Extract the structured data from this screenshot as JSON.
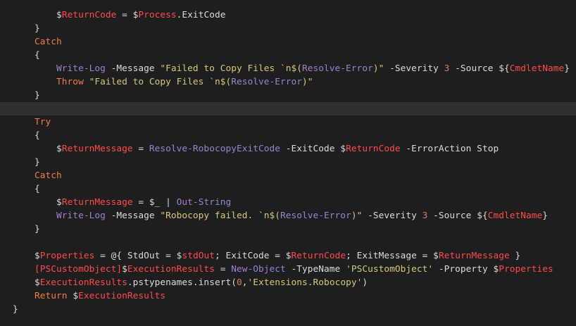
{
  "editor": {
    "colors": {
      "background": "#1e1e1e",
      "current_line": "#303030",
      "default": "#dcdcdc",
      "variable": "#ff4b4b",
      "keyword": "#f27d43",
      "cmdlet": "#a080d0",
      "string": "#d6c97a",
      "number": "#d08060",
      "type": "#ff4b4b"
    },
    "current_line_index": 7,
    "lines": [
      {
        "tokens": [
          {
            "t": "        ",
            "c": "default"
          },
          {
            "t": "$",
            "c": "default"
          },
          {
            "t": "ReturnCode",
            "c": "variable"
          },
          {
            "t": " = ",
            "c": "default"
          },
          {
            "t": "$",
            "c": "default"
          },
          {
            "t": "Process",
            "c": "variable"
          },
          {
            "t": ".ExitCode",
            "c": "default"
          }
        ]
      },
      {
        "tokens": [
          {
            "t": "    }",
            "c": "default"
          }
        ]
      },
      {
        "tokens": [
          {
            "t": "    ",
            "c": "default"
          },
          {
            "t": "Catch",
            "c": "keyword"
          }
        ]
      },
      {
        "tokens": [
          {
            "t": "    {",
            "c": "default"
          }
        ]
      },
      {
        "tokens": [
          {
            "t": "        ",
            "c": "default"
          },
          {
            "t": "Write-Log",
            "c": "cmdlet"
          },
          {
            "t": " -Message ",
            "c": "default"
          },
          {
            "t": "\"Failed to Copy Files `n$(",
            "c": "string"
          },
          {
            "t": "Resolve-Error",
            "c": "cmdlet"
          },
          {
            "t": ")\"",
            "c": "string"
          },
          {
            "t": " -Severity ",
            "c": "default"
          },
          {
            "t": "3",
            "c": "number"
          },
          {
            "t": " -Source ",
            "c": "default"
          },
          {
            "t": "${",
            "c": "default"
          },
          {
            "t": "CmdletName",
            "c": "variable"
          },
          {
            "t": "}",
            "c": "default"
          }
        ]
      },
      {
        "tokens": [
          {
            "t": "        ",
            "c": "default"
          },
          {
            "t": "Throw",
            "c": "keyword"
          },
          {
            "t": " ",
            "c": "default"
          },
          {
            "t": "\"Failed to Copy Files `n$(",
            "c": "string"
          },
          {
            "t": "Resolve-Error",
            "c": "cmdlet"
          },
          {
            "t": ")\"",
            "c": "string"
          }
        ]
      },
      {
        "tokens": [
          {
            "t": "    }",
            "c": "default"
          }
        ]
      },
      {
        "tokens": [
          {
            "t": "",
            "c": "default"
          }
        ]
      },
      {
        "tokens": [
          {
            "t": "    ",
            "c": "default"
          },
          {
            "t": "Try",
            "c": "keyword"
          }
        ]
      },
      {
        "tokens": [
          {
            "t": "    {",
            "c": "default"
          }
        ]
      },
      {
        "tokens": [
          {
            "t": "        ",
            "c": "default"
          },
          {
            "t": "$",
            "c": "default"
          },
          {
            "t": "ReturnMessage",
            "c": "variable"
          },
          {
            "t": " = ",
            "c": "default"
          },
          {
            "t": "Resolve-RobocopyExitCode",
            "c": "cmdlet"
          },
          {
            "t": " -ExitCode ",
            "c": "default"
          },
          {
            "t": "$",
            "c": "default"
          },
          {
            "t": "ReturnCode",
            "c": "variable"
          },
          {
            "t": " -ErrorAction Stop",
            "c": "default"
          }
        ]
      },
      {
        "tokens": [
          {
            "t": "    }",
            "c": "default"
          }
        ]
      },
      {
        "tokens": [
          {
            "t": "    ",
            "c": "default"
          },
          {
            "t": "Catch",
            "c": "keyword"
          }
        ]
      },
      {
        "tokens": [
          {
            "t": "    {",
            "c": "default"
          }
        ]
      },
      {
        "tokens": [
          {
            "t": "        ",
            "c": "default"
          },
          {
            "t": "$",
            "c": "default"
          },
          {
            "t": "ReturnMessage",
            "c": "variable"
          },
          {
            "t": " = ",
            "c": "default"
          },
          {
            "t": "$_",
            "c": "default"
          },
          {
            "t": " | ",
            "c": "default"
          },
          {
            "t": "Out-String",
            "c": "cmdlet"
          }
        ]
      },
      {
        "tokens": [
          {
            "t": "        ",
            "c": "default"
          },
          {
            "t": "Write-Log",
            "c": "cmdlet"
          },
          {
            "t": " -Message ",
            "c": "default"
          },
          {
            "t": "\"Robocopy failed. `n$(",
            "c": "string"
          },
          {
            "t": "Resolve-Error",
            "c": "cmdlet"
          },
          {
            "t": ")\"",
            "c": "string"
          },
          {
            "t": " -Severity ",
            "c": "default"
          },
          {
            "t": "3",
            "c": "number"
          },
          {
            "t": " -Source ",
            "c": "default"
          },
          {
            "t": "${",
            "c": "default"
          },
          {
            "t": "CmdletName",
            "c": "variable"
          },
          {
            "t": "}",
            "c": "default"
          }
        ]
      },
      {
        "tokens": [
          {
            "t": "    }",
            "c": "default"
          }
        ]
      },
      {
        "tokens": [
          {
            "t": "",
            "c": "default"
          }
        ]
      },
      {
        "tokens": [
          {
            "t": "    ",
            "c": "default"
          },
          {
            "t": "$",
            "c": "default"
          },
          {
            "t": "Properties",
            "c": "variable"
          },
          {
            "t": " = @{ StdOut = ",
            "c": "default"
          },
          {
            "t": "$",
            "c": "default"
          },
          {
            "t": "stdOut",
            "c": "variable"
          },
          {
            "t": "; ExitCode = ",
            "c": "default"
          },
          {
            "t": "$",
            "c": "default"
          },
          {
            "t": "ReturnCode",
            "c": "variable"
          },
          {
            "t": "; ExitMessage = ",
            "c": "default"
          },
          {
            "t": "$",
            "c": "default"
          },
          {
            "t": "ReturnMessage",
            "c": "variable"
          },
          {
            "t": " }",
            "c": "default"
          }
        ]
      },
      {
        "tokens": [
          {
            "t": "    ",
            "c": "default"
          },
          {
            "t": "[PSCustomObject]",
            "c": "type"
          },
          {
            "t": "$",
            "c": "default"
          },
          {
            "t": "ExecutionResults",
            "c": "variable"
          },
          {
            "t": " = ",
            "c": "default"
          },
          {
            "t": "New-Object",
            "c": "cmdlet"
          },
          {
            "t": " -TypeName ",
            "c": "default"
          },
          {
            "t": "'PSCustomObject'",
            "c": "string"
          },
          {
            "t": " -Property ",
            "c": "default"
          },
          {
            "t": "$",
            "c": "default"
          },
          {
            "t": "Properties",
            "c": "variable"
          }
        ]
      },
      {
        "tokens": [
          {
            "t": "    ",
            "c": "default"
          },
          {
            "t": "$",
            "c": "default"
          },
          {
            "t": "ExecutionResults",
            "c": "variable"
          },
          {
            "t": ".pstypenames.insert(",
            "c": "default"
          },
          {
            "t": "0",
            "c": "number"
          },
          {
            "t": ",",
            "c": "default"
          },
          {
            "t": "'Extensions.Robocopy'",
            "c": "string"
          },
          {
            "t": ")",
            "c": "default"
          }
        ]
      },
      {
        "tokens": [
          {
            "t": "    ",
            "c": "default"
          },
          {
            "t": "Return",
            "c": "keyword"
          },
          {
            "t": " ",
            "c": "default"
          },
          {
            "t": "$",
            "c": "default"
          },
          {
            "t": "ExecutionResults",
            "c": "variable"
          }
        ]
      },
      {
        "tokens": [
          {
            "t": "}",
            "c": "default"
          }
        ]
      }
    ]
  }
}
